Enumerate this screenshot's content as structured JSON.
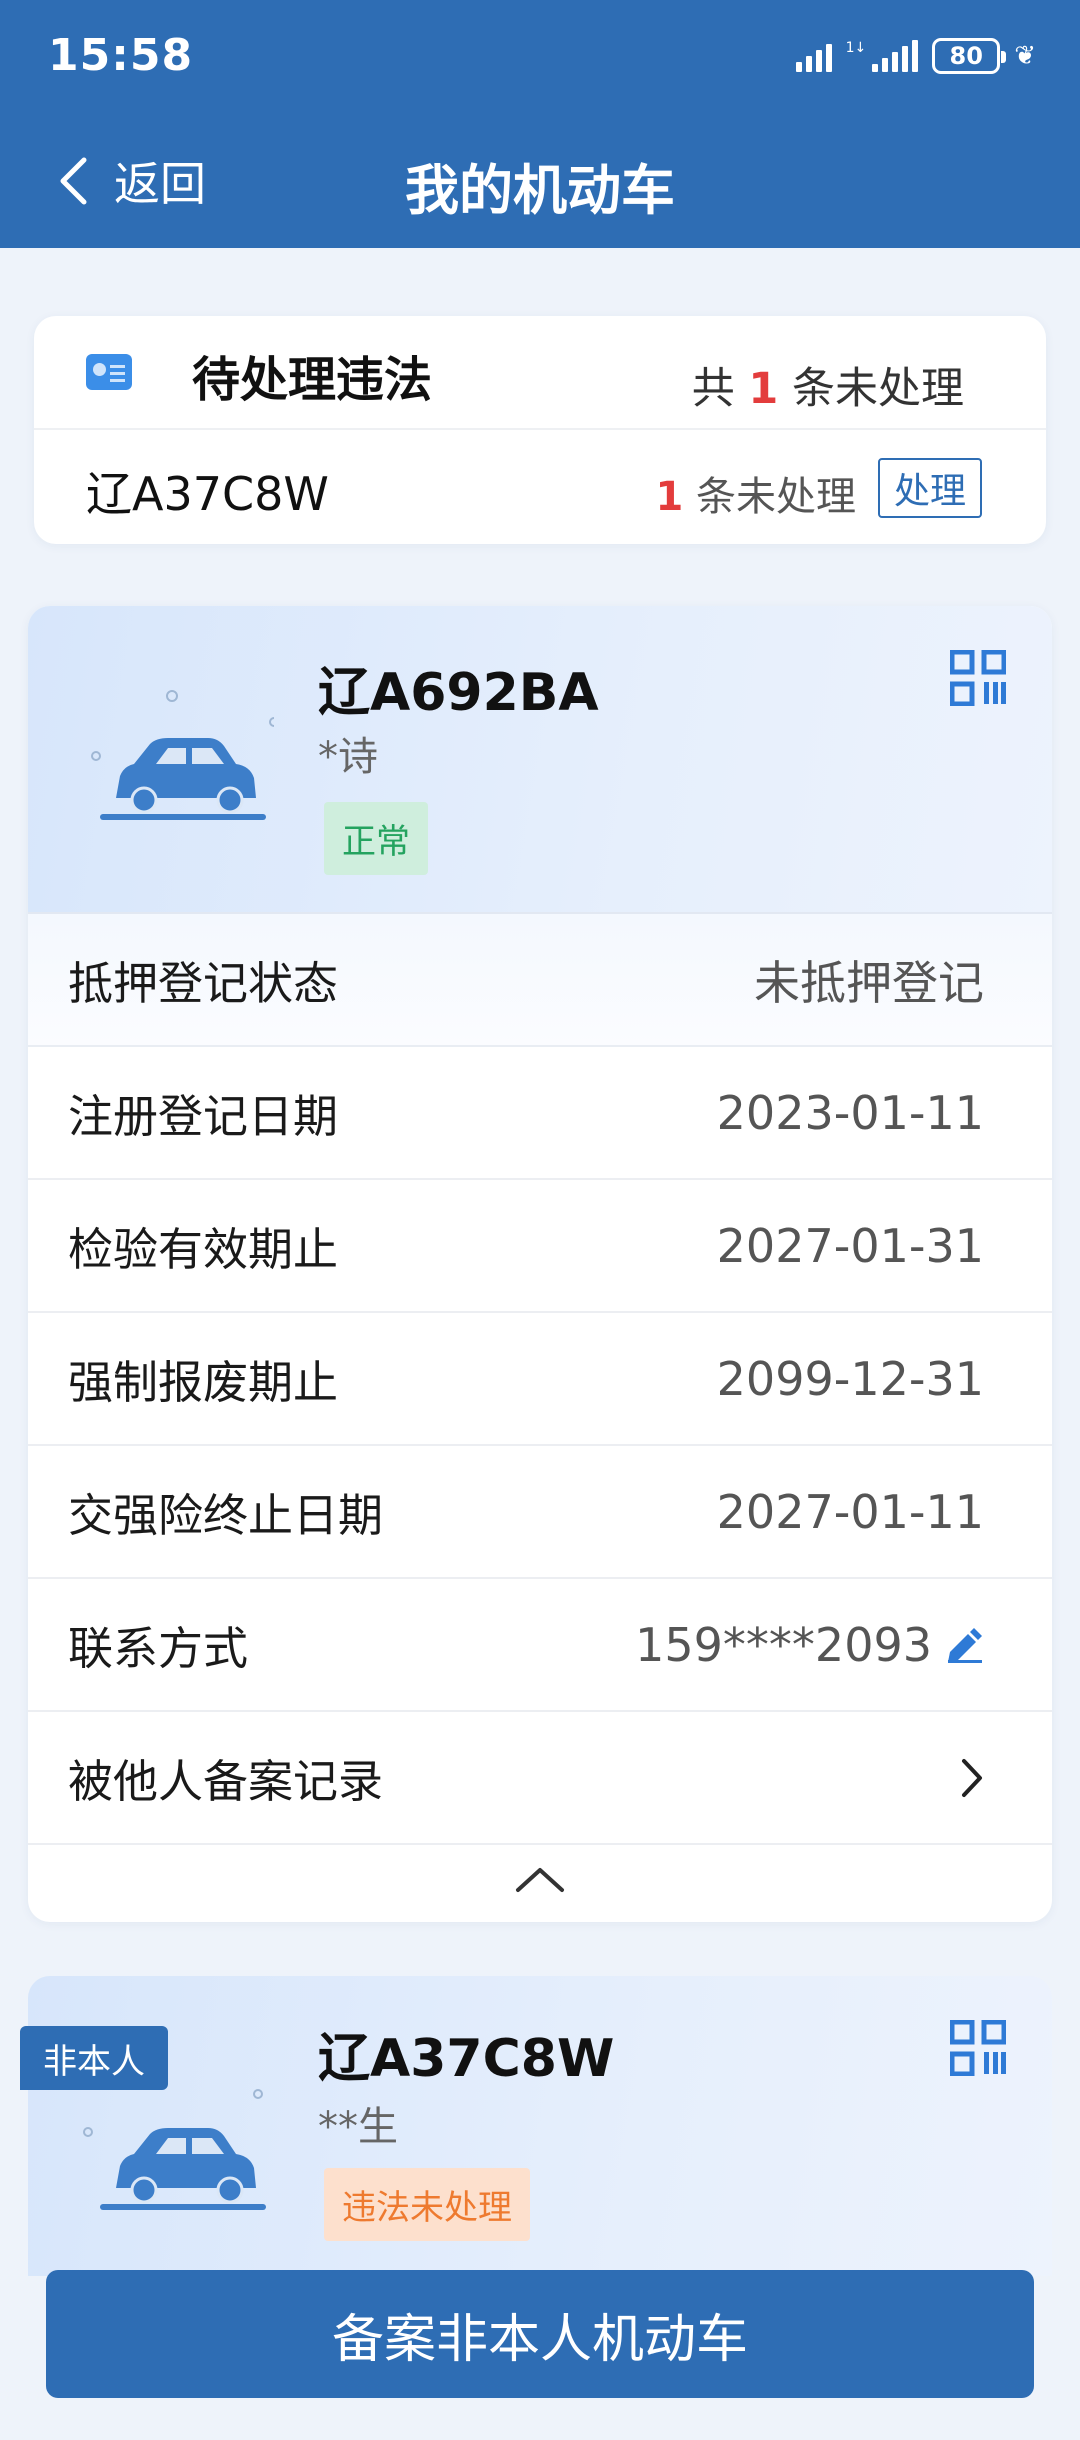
{
  "status_bar": {
    "time": "15:58",
    "battery": "80"
  },
  "header": {
    "back_label": "返回",
    "title": "我的机动车"
  },
  "pending": {
    "title": "待处理违法",
    "total_prefix": "共",
    "total_count": "1",
    "total_suffix": "条未处理",
    "plate": "辽A37C8W",
    "count": "1",
    "count_suffix": "条未处理",
    "action_label": "处理"
  },
  "vehicle1": {
    "plate": "辽A692BA",
    "owner": "*诗",
    "status_badge": "正常",
    "rows": [
      {
        "label": "抵押登记状态",
        "value": "未抵押登记"
      },
      {
        "label": "注册登记日期",
        "value": "2023-01-11"
      },
      {
        "label": "检验有效期止",
        "value": "2027-01-31"
      },
      {
        "label": "强制报废期止",
        "value": "2099-12-31"
      },
      {
        "label": "交强险终止日期",
        "value": "2027-01-11"
      },
      {
        "label": "联系方式",
        "value": "159****2093"
      },
      {
        "label": "被他人备案记录",
        "value": ""
      }
    ]
  },
  "vehicle2": {
    "tag": "非本人",
    "plate": "辽A37C8W",
    "owner": "**生",
    "status_badge": "违法未处理"
  },
  "bottom_button": {
    "label": "备案非本人机动车"
  },
  "colors": {
    "primary": "#2e6db4",
    "alert": "#e33c3c",
    "ok": "#24a35f",
    "warn": "#ee7a2f"
  }
}
